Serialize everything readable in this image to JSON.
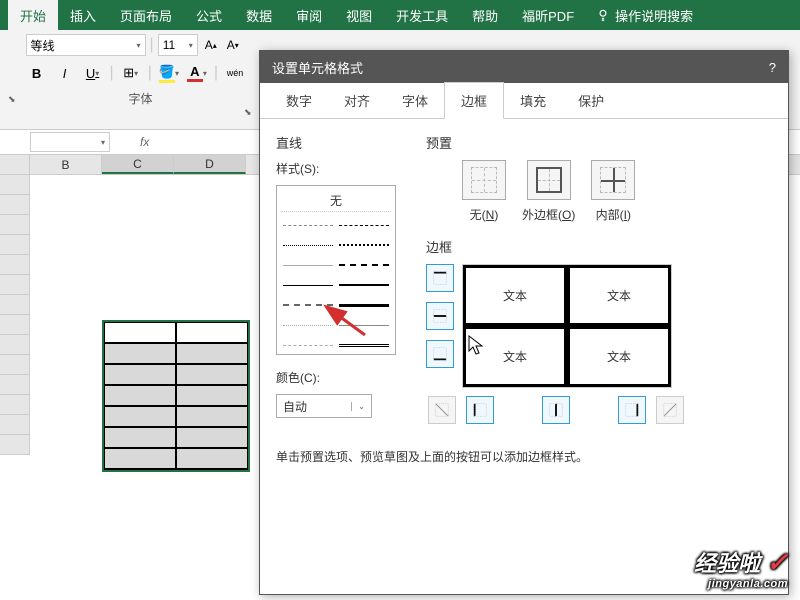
{
  "ribbon": {
    "tabs": [
      "开始",
      "插入",
      "页面布局",
      "公式",
      "数据",
      "审阅",
      "视图",
      "开发工具",
      "帮助",
      "福昕PDF"
    ],
    "tell_me": "操作说明搜索",
    "font_name": "等线",
    "font_size": "11",
    "group_font": "字体",
    "bold": "B",
    "italic": "I",
    "underline": "U",
    "font_color_letter": "A",
    "wenzi": "wén"
  },
  "formula": {
    "fx": "fx"
  },
  "columns": [
    "B",
    "C",
    "D"
  ],
  "dialog": {
    "title": "设置单元格格式",
    "help": "?",
    "tabs": [
      "数字",
      "对齐",
      "字体",
      "边框",
      "填充",
      "保护"
    ],
    "line_section": "直线",
    "style_label": "样式(S):",
    "style_none": "无",
    "color_label": "颜色(C):",
    "color_value": "自动",
    "preset_section": "预置",
    "preset_none": "无(N)",
    "preset_outer": "外边框(O)",
    "preset_inner": "内部(I)",
    "border_section": "边框",
    "preview_text": "文本",
    "hint": "单击预置选项、预览草图及上面的按钮可以添加边框样式。"
  },
  "watermark": {
    "big": "经验啦",
    "small": "jingyanla.com"
  }
}
